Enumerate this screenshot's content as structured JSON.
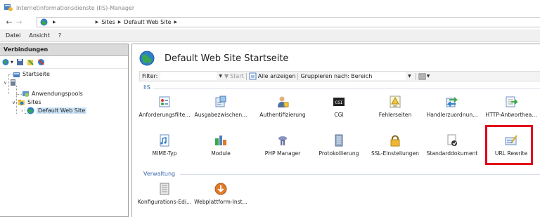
{
  "window": {
    "title": "Internetinformationsdienste (IIS)-Manager"
  },
  "address": {
    "segments": [
      "Sites",
      "Default Web Site"
    ]
  },
  "menu": {
    "items": [
      "Datei",
      "Ansicht",
      "?"
    ]
  },
  "connections": {
    "header": "Verbindungen",
    "tree": {
      "start": "Startseite",
      "app_pools": "Anwendungspools",
      "sites": "Sites",
      "default_site": "Default Web Site"
    }
  },
  "main": {
    "title": "Default Web Site Startseite",
    "filter": {
      "label": "Filter:",
      "start": "Start",
      "show_all": "Alle anzeigen",
      "group_label": "Gruppieren nach:",
      "group_value": "Bereich"
    },
    "groups": {
      "iis": "IIS",
      "verwaltung": "Verwaltung"
    },
    "features": [
      "Anforderungsfilte...",
      "Ausgabezwischen...",
      "Authentifizierung",
      "CGI",
      "Fehlerseiten",
      "Handlerzuordnun...",
      "HTTP-Antwortheа...",
      "MIME-Typ",
      "Module",
      "PHP Manager",
      "Protokollierung",
      "SSL-Einstellungen",
      "Standarddokument",
      "URL Rewrite"
    ],
    "mgmt_features": [
      "Konfigurations-Edi...",
      "Webplattform-Inst..."
    ]
  },
  "colors": {
    "highlight": "#e2001a",
    "group": "#3a68a8"
  }
}
